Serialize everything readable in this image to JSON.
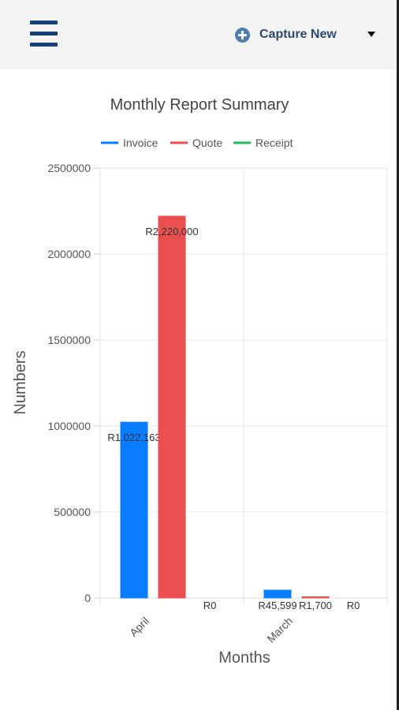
{
  "header": {
    "menu_icon": "hamburger-menu-icon",
    "capture_icon": "plus-circle-icon",
    "capture_label": "Capture New",
    "dropdown_icon": "caret-down-icon"
  },
  "chart_data": {
    "type": "bar",
    "title": "Monthly Report Summary",
    "xlabel": "Months",
    "ylabel": "Numbers",
    "ylim": [
      0,
      2500000
    ],
    "yticks": [
      0,
      500000,
      1000000,
      1500000,
      2000000,
      2500000
    ],
    "categories": [
      "April",
      "March"
    ],
    "series": [
      {
        "name": "Invoice",
        "color": "#0a7cff",
        "values": [
          1022163,
          45599
        ],
        "labels": [
          "R1,022,163",
          "R45,599"
        ]
      },
      {
        "name": "Quote",
        "color": "#ec4f4f",
        "values": [
          2220000,
          1700
        ],
        "labels": [
          "R2,220,000",
          "R1,700"
        ]
      },
      {
        "name": "Receipt",
        "color": "#22bb55",
        "values": [
          0,
          0
        ],
        "labels": [
          "R0",
          "R0"
        ]
      }
    ],
    "legend_position": "top",
    "grid": true
  }
}
